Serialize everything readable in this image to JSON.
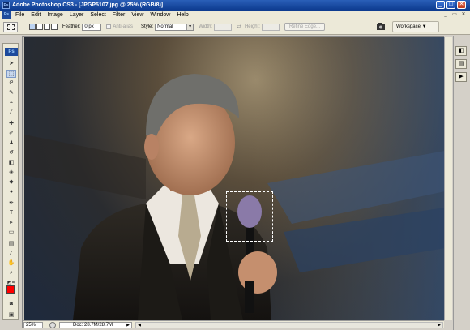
{
  "window": {
    "title": "Adobe Photoshop CS3 - [JPGP5107.jpg @ 25% (RGB/8)]",
    "controls": [
      "_",
      "□",
      "✕"
    ]
  },
  "menu": [
    "File",
    "Edit",
    "Image",
    "Layer",
    "Select",
    "Filter",
    "View",
    "Window",
    "Help"
  ],
  "options": {
    "feather_label": "Feather:",
    "feather_value": "0 px",
    "antialias_label": "Anti-alias",
    "style_label": "Style:",
    "style_value": "Normal",
    "width_label": "Width:",
    "height_label": "Height:",
    "refine_edge": "Refine Edge...",
    "workspace": "Workspace ▼"
  },
  "toolbox": {
    "logo": "Ps",
    "tools": [
      "move-tool",
      "marquee-tool",
      "lasso-tool",
      "quick-select-tool",
      "crop-tool",
      "eyedropper-tool",
      "healing-brush-tool",
      "brush-tool",
      "clone-stamp-tool",
      "history-brush-tool",
      "eraser-tool",
      "paint-bucket-tool",
      "blur-tool",
      "dodge-tool",
      "pen-tool",
      "type-tool",
      "path-select-tool",
      "shape-tool",
      "notes-tool",
      "eyedropper2-tool",
      "hand-tool",
      "zoom-tool"
    ],
    "foreground_color": "#ff0000",
    "background_color": "#ffffff"
  },
  "status": {
    "zoom": "25%",
    "doc_info": "Doc: 28.7M/28.7M"
  },
  "colors": {
    "titlebar": "#0c3a8e",
    "chrome": "#ece9d8",
    "accent": "#1d4a9c"
  }
}
